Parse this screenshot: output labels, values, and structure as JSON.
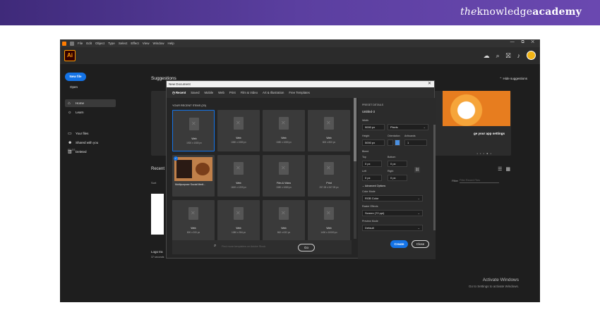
{
  "brand": {
    "prefix": "the",
    "main": "knowledge",
    "bold": "academy"
  },
  "menubar": {
    "items": [
      "File",
      "Edit",
      "Object",
      "Type",
      "Select",
      "Effect",
      "View",
      "Window",
      "Help"
    ],
    "window_controls": "— ⧉ ✕"
  },
  "app": {
    "logo": "Ai"
  },
  "sidebar": {
    "new_file": "New file",
    "open": "Open",
    "home": "Home",
    "learn": "Learn",
    "files_label": "FILES",
    "your_files": "Your files",
    "shared": "Shared with you",
    "deleted": "Deleted"
  },
  "main": {
    "suggestions": "Suggestions",
    "hide_suggestions": "Hide suggestions",
    "promo_text": "ge your app settings",
    "recent": "Recent",
    "sort": "Sort",
    "filter": "Filter",
    "filter_placeholder": "Filter Recent Files",
    "logo_title": "Logo tra",
    "logo_sub": "37 seconds",
    "activate_title": "Activate Windows",
    "activate_sub": "Go to Settings to activate Windows."
  },
  "dialog": {
    "title": "New Document",
    "tabs": [
      "Recent",
      "Saved",
      "Mobile",
      "Web",
      "Print",
      "Film & Video",
      "Art & Illustration",
      "Free Templates"
    ],
    "recent_items_label": "YOUR RECENT ITEMS (20)",
    "tiles": [
      {
        "name": "Web",
        "size": "1920 x 1080 px"
      },
      {
        "name": "Web",
        "size": "1080 x 1080 px"
      },
      {
        "name": "Web",
        "size": "1080 x 1080 px"
      },
      {
        "name": "Web",
        "size": "800 x 800 px"
      },
      {
        "name": "Multipurpose Social Medi...",
        "size": ""
      },
      {
        "name": "Web",
        "size": "1600 x 1200 px"
      },
      {
        "name": "Film & Video",
        "size": "1080 x 1080 px"
      },
      {
        "name": "Print",
        "size": "297.28 x 347.09 px"
      },
      {
        "name": "Web",
        "size": "800 x 200 px"
      },
      {
        "name": "Web",
        "size": "1080 x 284 px"
      },
      {
        "name": "Web",
        "size": "862 x 632 px"
      },
      {
        "name": "Web",
        "size": "1400 x 10000 px"
      }
    ],
    "search_placeholder": "Find more templates on Adobe Stock",
    "go": "Go",
    "preset": {
      "heading": "PRESET DETAILS",
      "name": "Untitled-3",
      "width_label": "Width",
      "width_value": "9000 px",
      "units": "Pixels",
      "height_label": "Height",
      "height_value": "5000 px",
      "orientation_label": "Orientation",
      "artboards_label": "Artboards",
      "artboards_value": "1",
      "bleed_label": "Bleed",
      "top_label": "Top",
      "top_value": "0 px",
      "bottom_label": "Bottom",
      "bottom_value": "0 px",
      "left_label": "Left",
      "left_value": "0 px",
      "right_label": "Right",
      "right_value": "0 px",
      "advanced": "Advanced Options",
      "color_mode_label": "Color Mode",
      "color_mode": "RGB Color",
      "raster_label": "Raster Effects",
      "raster": "Screen (72 ppi)",
      "preview_label": "Preview Mode",
      "preview": "Default",
      "create": "Create",
      "close": "Close"
    }
  }
}
